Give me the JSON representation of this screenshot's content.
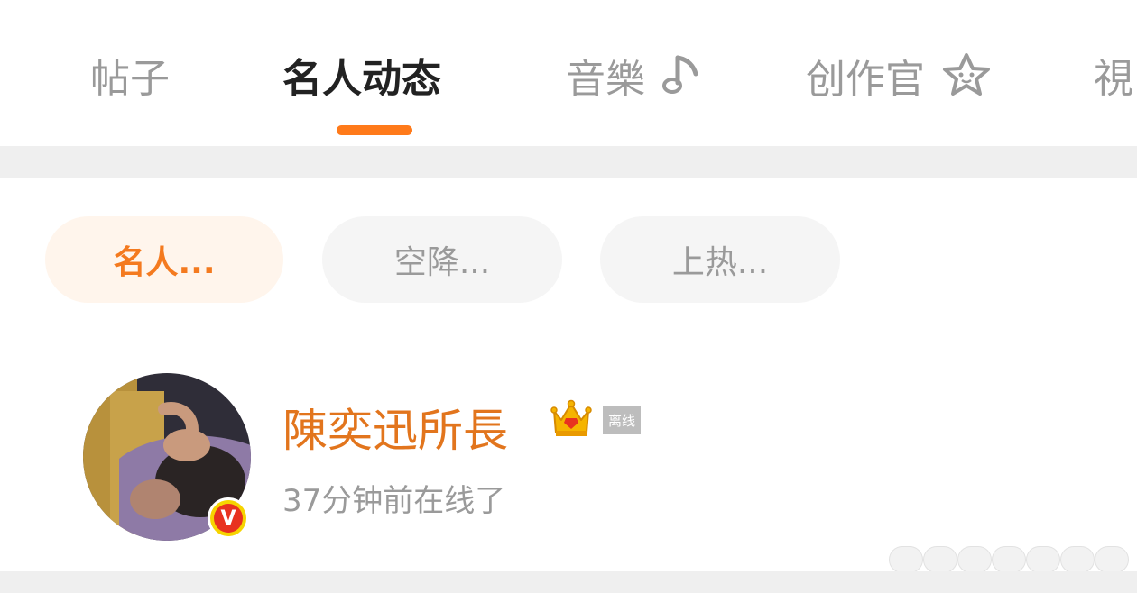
{
  "tabs": [
    {
      "label": "帖子"
    },
    {
      "label": "名人动态"
    },
    {
      "label": "音樂"
    },
    {
      "label": "创作官"
    },
    {
      "label": "視"
    }
  ],
  "filters": [
    {
      "label": "名人..."
    },
    {
      "label": "空降..."
    },
    {
      "label": "上热..."
    }
  ],
  "user": {
    "name": "陳奕迅所長",
    "status_tag": "离线",
    "last_seen": "37分钟前在线了",
    "verified_badge": "V"
  },
  "colors": {
    "accent": "#ff7a1a",
    "username": "#e2751d",
    "inactive_text": "#9a9a9a",
    "active_text": "#222222"
  },
  "icons": [
    "music-note-icon",
    "star-icon",
    "crown-icon",
    "verified-v-icon"
  ]
}
